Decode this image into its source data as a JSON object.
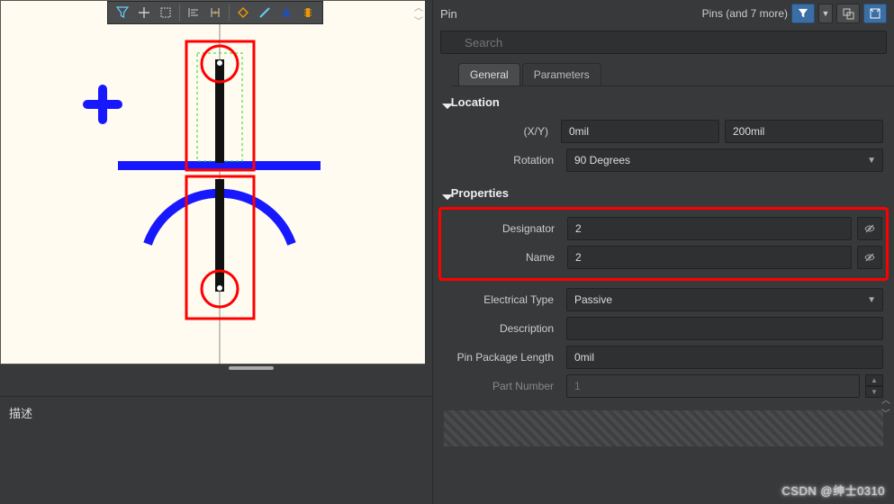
{
  "header": {
    "title": "Pin",
    "filter_text": "Pins (and 7 more)"
  },
  "search": {
    "placeholder": "Search"
  },
  "tabs": {
    "general": "General",
    "parameters": "Parameters"
  },
  "location": {
    "section": "Location",
    "xy_label": "(X/Y)",
    "x": "0mil",
    "y": "200mil",
    "rotation_label": "Rotation",
    "rotation": "90 Degrees"
  },
  "properties": {
    "section": "Properties",
    "designator_label": "Designator",
    "designator": "2",
    "name_label": "Name",
    "name": "2",
    "electrical_type_label": "Electrical Type",
    "electrical_type": "Passive",
    "description_label": "Description",
    "description": "",
    "pkg_len_label": "Pin Package Length",
    "pkg_len": "0mil",
    "part_no_label": "Part Number",
    "part_no": "1"
  },
  "desc_panel": {
    "title": "描述"
  },
  "watermark": "CSDN @绅士0310"
}
